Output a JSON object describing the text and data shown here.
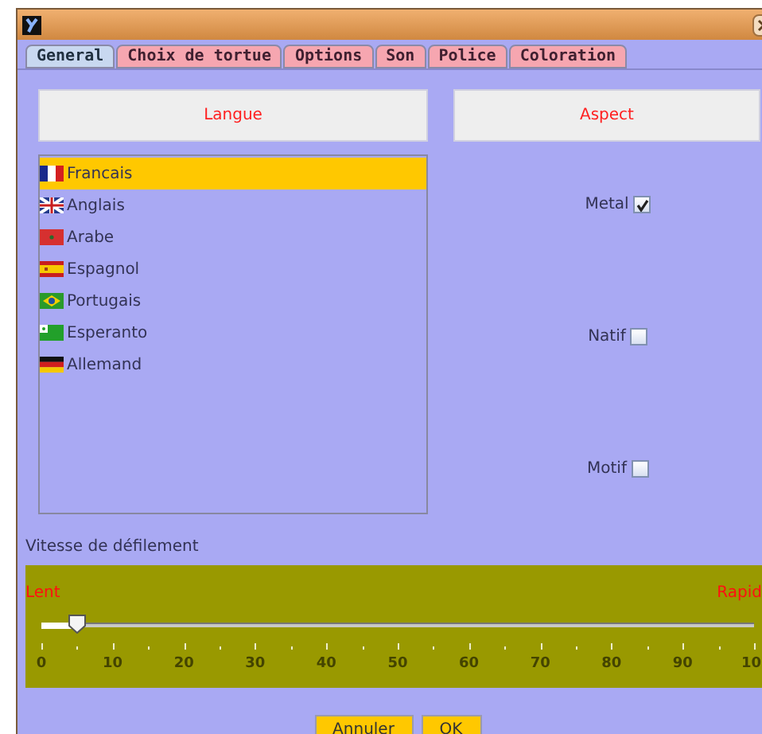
{
  "tabs": [
    {
      "label": "General",
      "selected": true
    },
    {
      "label": "Choix de tortue",
      "selected": false
    },
    {
      "label": "Options",
      "selected": false
    },
    {
      "label": "Son",
      "selected": false
    },
    {
      "label": "Police",
      "selected": false
    },
    {
      "label": "Coloration",
      "selected": false
    }
  ],
  "language": {
    "title": "Langue",
    "items": [
      {
        "label": "Francais",
        "selected": true
      },
      {
        "label": "Anglais",
        "selected": false
      },
      {
        "label": "Arabe",
        "selected": false
      },
      {
        "label": "Espagnol",
        "selected": false
      },
      {
        "label": "Portugais",
        "selected": false
      },
      {
        "label": "Esperanto",
        "selected": false
      },
      {
        "label": "Allemand",
        "selected": false
      }
    ]
  },
  "aspect": {
    "title": "Aspect",
    "options": [
      {
        "label": "Metal",
        "checked": true
      },
      {
        "label": "Natif",
        "checked": false
      },
      {
        "label": "Motif",
        "checked": false
      }
    ]
  },
  "speed": {
    "label": "Vitesse de défilement",
    "min_label": "Lent",
    "max_label": "Rapid",
    "level": 0.05,
    "ticks": [
      "0",
      "10",
      "20",
      "30",
      "40",
      "50",
      "60",
      "70",
      "80",
      "90",
      "10"
    ]
  },
  "buttons": [
    "Annuler",
    "OK"
  ]
}
